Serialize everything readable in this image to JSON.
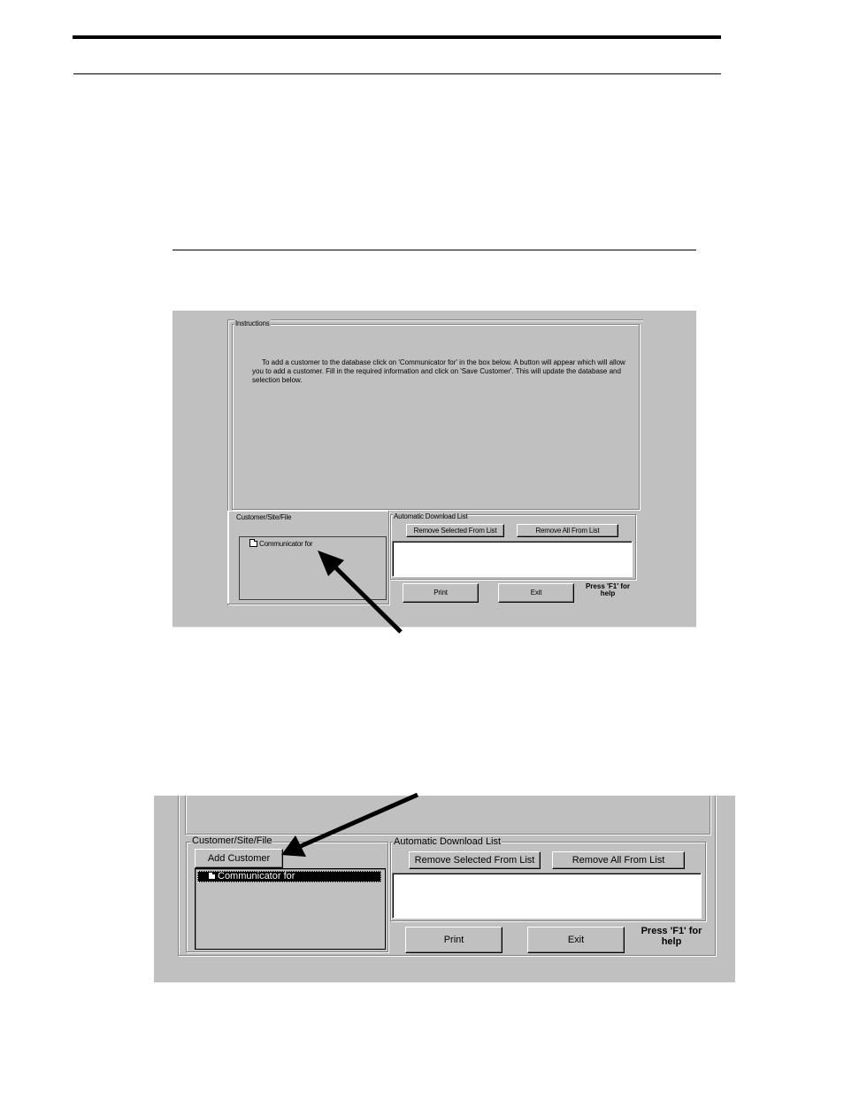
{
  "page": {
    "rules": [
      "header-thick-rule",
      "header-thin-rule",
      "section-rule"
    ]
  },
  "screenshot1": {
    "instructions_group": {
      "label": "Instructions",
      "text_lines": [
        "To add a customer to the database click on 'Communicator for' in the box below. A button will appear which will allow",
        "you to add a customer. Fill in the required information and click on 'Save Customer'. This will update the database and",
        "selection below."
      ]
    },
    "customer_group": {
      "label": "Customer/Site/File",
      "tree_items": [
        {
          "label": "Communicator for",
          "icon": "folder-icon",
          "selected": false
        }
      ]
    },
    "download_group": {
      "label": "Automatic Download List",
      "remove_selected_label": "Remove Selected From List",
      "remove_all_label": "Remove All From List",
      "list_items": []
    },
    "print_label": "Print",
    "exit_label": "Exit",
    "help_text_line1": "Press 'F1' for",
    "help_text_line2": "help",
    "annotation": "arrow-pointing-to-communicator-for"
  },
  "screenshot2": {
    "customer_group": {
      "label": "Customer/Site/File",
      "add_customer_label": "Add Customer",
      "tree_items": [
        {
          "label": "Communicator for",
          "icon": "folder-icon",
          "selected": true
        }
      ]
    },
    "download_group": {
      "label": "Automatic Download List",
      "remove_selected_label": "Remove Selected From List",
      "remove_all_label": "Remove All From List",
      "list_items": []
    },
    "print_label": "Print",
    "exit_label": "Exit",
    "help_text_line1": "Press 'F1' for",
    "help_text_line2": "help",
    "annotation": "arrow-pointing-to-add-customer"
  }
}
